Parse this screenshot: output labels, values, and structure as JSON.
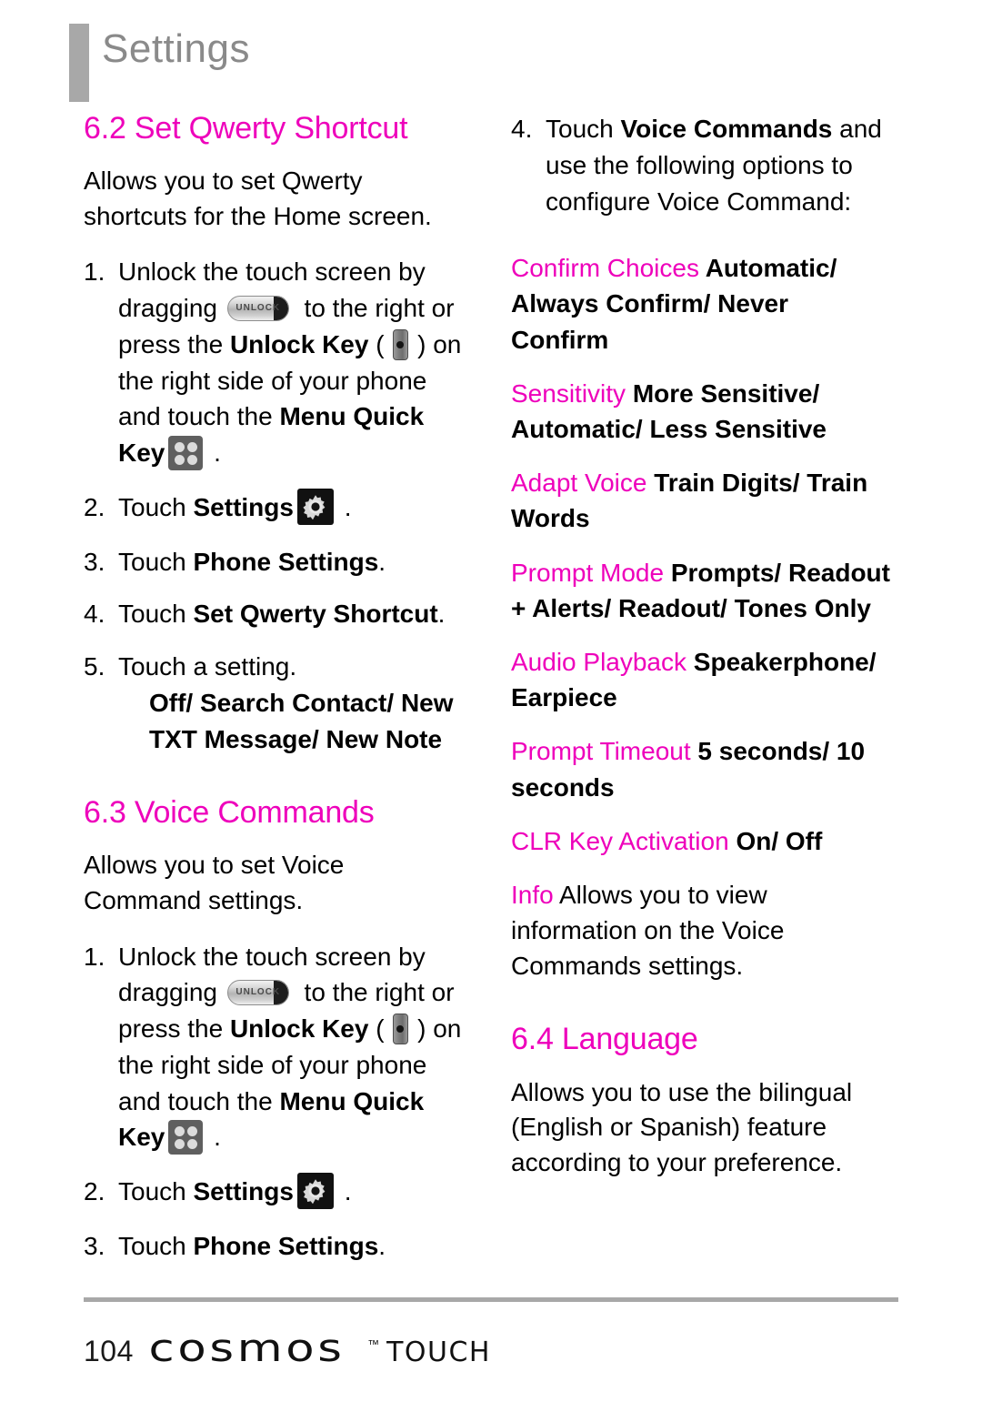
{
  "header": {
    "title": "Settings"
  },
  "icons": {
    "unlock_slider": "unlock-slider-icon",
    "unlock_slider_label": "UNLOCK",
    "unlock_key": "unlock-key-icon",
    "menu_quick_key": "menu-quick-key-icon",
    "settings_gear": "settings-gear-icon"
  },
  "colors": {
    "accent_magenta": "#EE00BB",
    "header_gray": "#8A8A8A",
    "rule_gray": "#A8A8A8"
  },
  "left_column": {
    "section_qwerty": {
      "heading": "6.2 Set Qwerty Shortcut",
      "intro": "Allows you to set Qwerty shortcuts for the Home screen.",
      "steps": [
        {
          "num": "1.",
          "part1": "Unlock the touch screen by dragging ",
          "part2": " to the right or press the ",
          "bold1": "Unlock Key",
          "part3": " ( ",
          "part4": " ) on the right side of your phone and touch the ",
          "bold2": "Menu Quick Key",
          "part5": " ."
        },
        {
          "num": "2.",
          "part1": "Touch ",
          "bold1": "Settings",
          "part2": " ."
        },
        {
          "num": "3.",
          "part1": "Touch ",
          "bold1": "Phone Settings",
          "part2": "."
        },
        {
          "num": "4.",
          "part1": "Touch ",
          "bold1": "Set Qwerty Shortcut",
          "part2": "."
        },
        {
          "num": "5.",
          "part1": "Touch a setting.",
          "bold1": "Off/ Search Contact/ New TXT Message/ New Note"
        }
      ]
    },
    "section_voice": {
      "heading": "6.3 Voice Commands",
      "intro": "Allows you to set Voice Command settings.",
      "steps": [
        {
          "num": "1.",
          "part1": "Unlock the touch screen by dragging ",
          "part2": " to the right or press the ",
          "bold1": "Unlock Key",
          "part3": " ( ",
          "part4": " ) on the right side of your phone and touch the ",
          "bold2": "Menu Quick Key",
          "part5": " ."
        },
        {
          "num": "2.",
          "part1": "Touch ",
          "bold1": "Settings",
          "part2": " ."
        },
        {
          "num": "3.",
          "part1": "Touch ",
          "bold1": "Phone Settings",
          "part2": "."
        }
      ]
    }
  },
  "right_column": {
    "step4": {
      "num": "4.",
      "part1": "Touch ",
      "bold1": "Voice Commands",
      "part2": " and use the following options to configure Voice Command:"
    },
    "options": [
      {
        "label": "Confirm Choices",
        "value": " Automatic/ Always Confirm/ Never Confirm",
        "bold": true
      },
      {
        "label": "Sensitivity",
        "value": " More Sensitive/ Automatic/ Less Sensitive",
        "bold": true
      },
      {
        "label": "Adapt Voice",
        "value": " Train Digits/ Train Words",
        "bold": true
      },
      {
        "label": "Prompt Mode",
        "value": "  Prompts/ Readout + Alerts/ Readout/ Tones Only",
        "bold": true
      },
      {
        "label": "Audio Playback",
        "value": "  Speakerphone/ Earpiece",
        "bold": true
      },
      {
        "label": "Prompt Timeout",
        "value": "  5 seconds/ 10 seconds",
        "bold": true
      },
      {
        "label": "CLR Key Activation",
        "value": "  On/ Off",
        "bold": true
      },
      {
        "label": "Info",
        "value": "  Allows you to view information on the Voice Commands settings.",
        "bold": false
      }
    ],
    "section_language": {
      "heading": "6.4 Language",
      "intro": "Allows you to use the bilingual (English or Spanish) feature according to your preference."
    }
  },
  "footer": {
    "page_number": "104",
    "brand_name": "cosmos",
    "brand_tm": "™",
    "brand_product": "TOUCH"
  }
}
